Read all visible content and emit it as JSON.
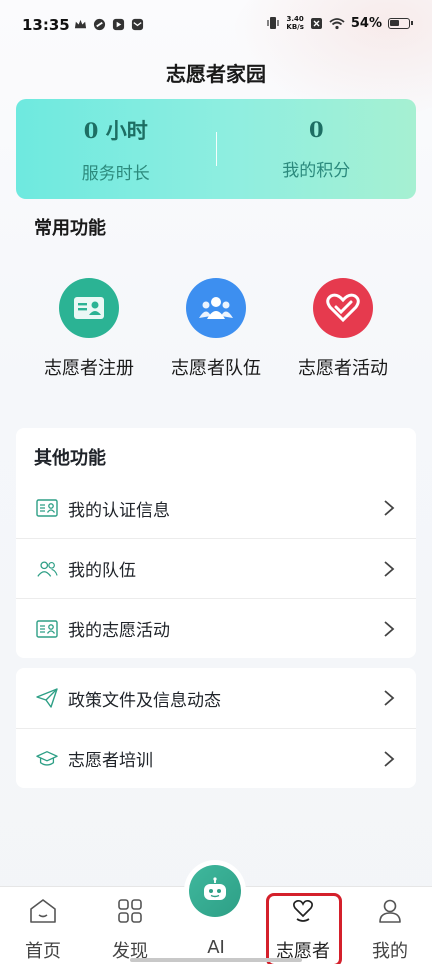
{
  "status_bar": {
    "time": "13:35",
    "net_speed_value": "3.40",
    "net_speed_unit": "KB/s",
    "battery": "54%"
  },
  "page": {
    "title": "志愿者家园"
  },
  "stats": [
    {
      "value": "0 小时",
      "label": "服务时长"
    },
    {
      "value": "0",
      "label": "我的积分"
    }
  ],
  "common": {
    "title": "常用功能",
    "items": [
      {
        "label": "志愿者注册",
        "icon": "id-card-icon",
        "color": "#2bb394"
      },
      {
        "label": "志愿者队伍",
        "icon": "team-icon",
        "color": "#3d8ff0"
      },
      {
        "label": "志愿者活动",
        "icon": "heart-icon",
        "color": "#e63a4e"
      }
    ]
  },
  "other": {
    "title": "其他功能",
    "items": [
      {
        "label": "我的认证信息",
        "icon": "id-card-outline-icon"
      },
      {
        "label": "我的队伍",
        "icon": "people-outline-icon"
      },
      {
        "label": "我的志愿活动",
        "icon": "id-card-outline-icon"
      }
    ]
  },
  "more": {
    "items": [
      {
        "label": "政策文件及信息动态",
        "icon": "paper-plane-icon"
      },
      {
        "label": "志愿者培训",
        "icon": "graduation-cap-icon"
      }
    ]
  },
  "nav": {
    "items": [
      {
        "label": "首页",
        "icon": "home-icon"
      },
      {
        "label": "发现",
        "icon": "grid-icon"
      },
      {
        "label": "AI",
        "icon": "robot-icon"
      },
      {
        "label": "志愿者",
        "icon": "volunteer-heart-icon",
        "active": true
      },
      {
        "label": "我的",
        "icon": "user-icon"
      }
    ]
  },
  "colors": {
    "accent": "#2e9f86",
    "highlight": "#d4202b"
  }
}
